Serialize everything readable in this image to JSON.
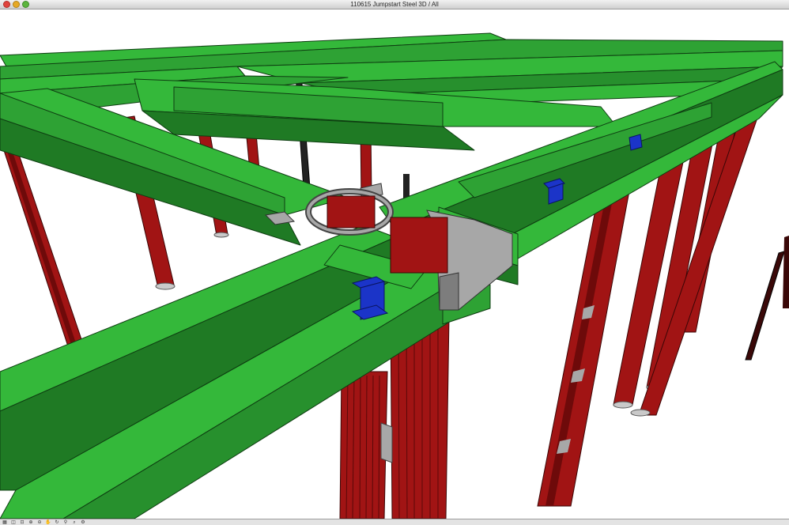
{
  "window": {
    "title": "110615 Jumpstart Steel 3D / All"
  },
  "colors": {
    "beam_green": "#34b83a",
    "beam_dark": "#1f7a24",
    "column_red": "#a11414",
    "column_dark": "#5a0808",
    "connector_blue": "#1b34c8",
    "plate_grey": "#a7a7a7"
  },
  "toolbar": {
    "tools": [
      {
        "icon": "grid-icon",
        "glyph": "▦"
      },
      {
        "icon": "zoom-fit-icon",
        "glyph": "◫"
      },
      {
        "icon": "zoom-window-icon",
        "glyph": "⊡"
      },
      {
        "icon": "zoom-in-icon",
        "glyph": "⊕"
      },
      {
        "icon": "zoom-out-icon",
        "glyph": "⊖"
      },
      {
        "icon": "pan-icon",
        "glyph": "✋"
      },
      {
        "icon": "orbit-icon",
        "glyph": "↻"
      },
      {
        "icon": "walk-icon",
        "glyph": "⚲"
      },
      {
        "icon": "magnify-icon",
        "glyph": "⌕"
      },
      {
        "icon": "settings-icon",
        "glyph": "⚙"
      }
    ]
  }
}
